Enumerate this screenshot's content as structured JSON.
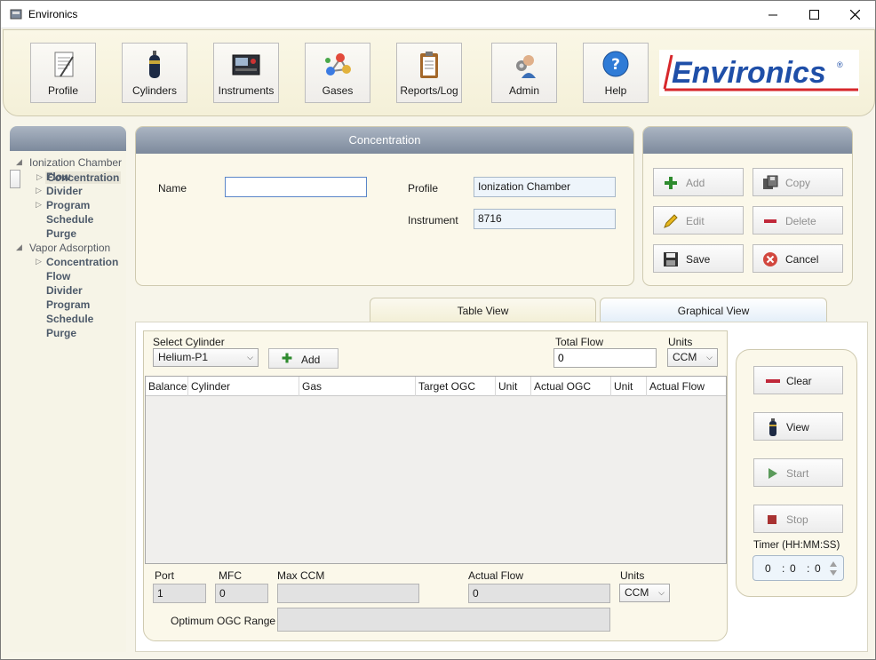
{
  "window": {
    "title": "Environics"
  },
  "toolbar": {
    "buttons": [
      {
        "label": "Profile",
        "icon": "profile-icon"
      },
      {
        "label": "Cylinders",
        "icon": "cylinder-icon"
      },
      {
        "label": "Instruments",
        "icon": "instrument-icon"
      },
      {
        "label": "Gases",
        "icon": "molecule-icon"
      },
      {
        "label": "Reports/Log",
        "icon": "clipboard-icon"
      },
      {
        "label": "Admin",
        "icon": "admin-icon"
      },
      {
        "label": "Help",
        "icon": "help-icon"
      }
    ],
    "logo_text": "Environics",
    "logo_color": "#1f4fa8",
    "logo_accent": "#d7272b"
  },
  "tree": {
    "groups": [
      {
        "label": "Ionization Chamber",
        "items": [
          "Concentration",
          "Flow",
          "Divider",
          "Program",
          "Schedule",
          "Purge"
        ]
      },
      {
        "label": "Vapor Adsorption",
        "items": [
          "Concentration",
          "Flow",
          "Divider",
          "Program",
          "Schedule",
          "Purge"
        ]
      }
    ],
    "selected": "Concentration"
  },
  "concentration": {
    "title": "Concentration",
    "name_label": "Name",
    "name_value": "",
    "profile_label": "Profile",
    "profile_value": "Ionization Chamber",
    "instrument_label": "Instrument",
    "instrument_value": "8716"
  },
  "actions": {
    "add": "Add",
    "copy": "Copy",
    "edit": "Edit",
    "delete": "Delete",
    "save": "Save",
    "cancel": "Cancel"
  },
  "tabs": {
    "table": "Table View",
    "graphical": "Graphical View"
  },
  "table_view": {
    "select_cylinder_label": "Select Cylinder",
    "cylinder_value": "Helium-P1",
    "add_label": "Add",
    "total_flow_label": "Total Flow",
    "total_flow_value": "0",
    "units_label": "Units",
    "units_value": "CCM",
    "columns": [
      "Balance",
      "Cylinder",
      "Gas",
      "Target OGC",
      "Unit",
      "Actual OGC",
      "Unit",
      "Actual Flow"
    ],
    "port_label": "Port",
    "port_value": "1",
    "mfc_label": "MFC",
    "mfc_value": "0",
    "max_ccm_label": "Max CCM",
    "max_ccm_value": "",
    "actual_flow_label": "Actual Flow",
    "actual_flow_value": "0",
    "units2_label": "Units",
    "units2_value": "CCM",
    "ogc_range_label": "Optimum OGC Range",
    "ogc_range_value": ""
  },
  "controls": {
    "clear": "Clear",
    "view": "View",
    "start": "Start",
    "stop": "Stop",
    "timer_label": "Timer (HH:MM:SS)",
    "timer_h": "0",
    "timer_m": "0",
    "timer_s": "0"
  }
}
